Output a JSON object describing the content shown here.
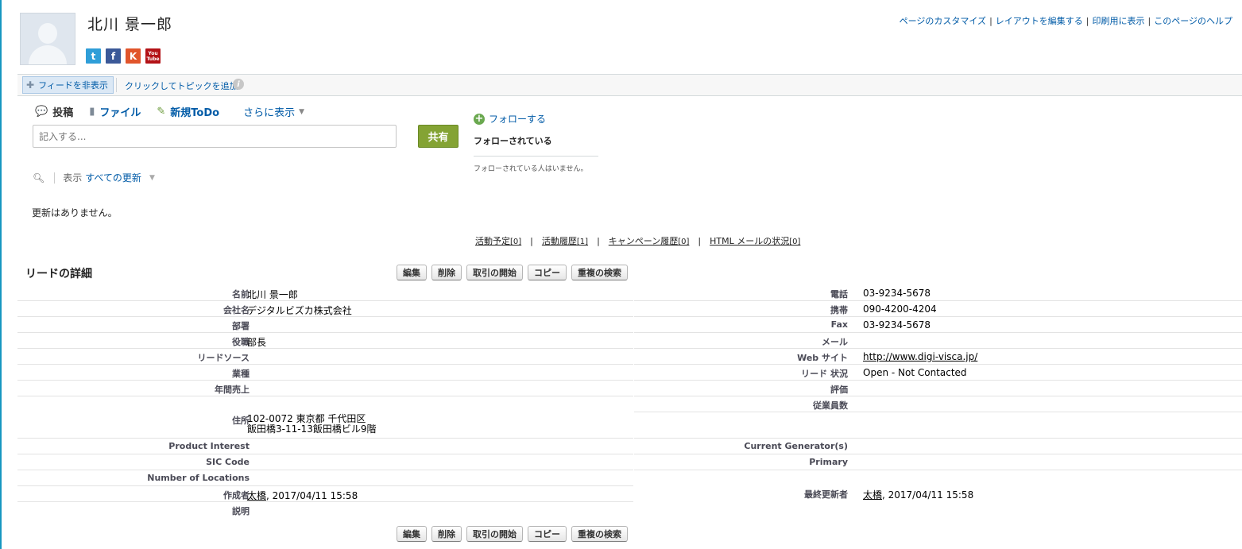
{
  "record": {
    "name": "北川 景一郎"
  },
  "social": {
    "twitter": "t",
    "facebook": "f",
    "klout": "K",
    "youtube_top": "You",
    "youtube_bottom": "Tube"
  },
  "top_links": [
    "ページのカスタマイズ",
    "レイアウトを編集する",
    "印刷用に表示",
    "このページのヘルプ"
  ],
  "feedbar": {
    "hide_feed": "フィードを非表示",
    "add_topics": "クリックしてトピックを追加:",
    "info": "i"
  },
  "publisher": {
    "tabs": [
      "投稿",
      "ファイル",
      "新規ToDo"
    ],
    "more": "さらに表示",
    "placeholder": "記入する...",
    "share": "共有"
  },
  "feed_filter": {
    "label": "表示",
    "value": "すべての更新"
  },
  "feed_empty": "更新はありません。",
  "follow": {
    "button": "フォローする",
    "followers_title": "フォローされている",
    "no_followers": "フォローされている人はいません。"
  },
  "related_links": [
    {
      "label": "活動予定",
      "count": "[0]"
    },
    {
      "label": "活動履歴",
      "count": "[1]"
    },
    {
      "label": "キャンペーン履歴",
      "count": "[0]"
    },
    {
      "label": "HTML メールの状況",
      "count": "[0]"
    }
  ],
  "detail": {
    "title": "リードの詳細",
    "buttons": [
      "編集",
      "削除",
      "取引の開始",
      "コピー",
      "重複の検索"
    ],
    "left_fields": [
      {
        "label": "名前",
        "value": "北川 景一郎"
      },
      {
        "label": "会社名",
        "value": "デジタルビズカ株式会社"
      },
      {
        "label": "部署",
        "value": ""
      },
      {
        "label": "役職",
        "value": "部長"
      },
      {
        "label": "リードソース",
        "value": ""
      },
      {
        "label": "業種",
        "value": ""
      },
      {
        "label": "年間売上",
        "value": ""
      },
      {
        "label": "住所",
        "value_line1": "102-0072 東京都 千代田区",
        "value_line2": "飯田橋3-11-13飯田橋ビル9階"
      },
      {
        "label": "Product Interest",
        "value": ""
      },
      {
        "label": "SIC Code",
        "value": ""
      },
      {
        "label": "Number of Locations",
        "value": ""
      },
      {
        "label": "作成者",
        "value_link": "太橋",
        "value_rest": ", 2017/04/11 15:58"
      },
      {
        "label": "説明",
        "value": ""
      }
    ],
    "right_fields": [
      {
        "label": "電話",
        "value": "03-9234-5678"
      },
      {
        "label": "携帯",
        "value": "090-4200-4204"
      },
      {
        "label": "Fax",
        "value": "03-9234-5678"
      },
      {
        "label": "メール",
        "value": ""
      },
      {
        "label": "Web サイト",
        "value": "http://www.digi-visca.jp/"
      },
      {
        "label": "リード 状況",
        "value": "Open - Not Contacted"
      },
      {
        "label": "評価",
        "value": ""
      },
      {
        "label": "従業員数",
        "value": ""
      },
      {
        "label": "Current Generator(s)",
        "value": ""
      },
      {
        "label": "Primary",
        "value": ""
      },
      {
        "label": "最終更新者",
        "value_link": "太橋",
        "value_rest": ", 2017/04/11 15:58"
      }
    ]
  }
}
